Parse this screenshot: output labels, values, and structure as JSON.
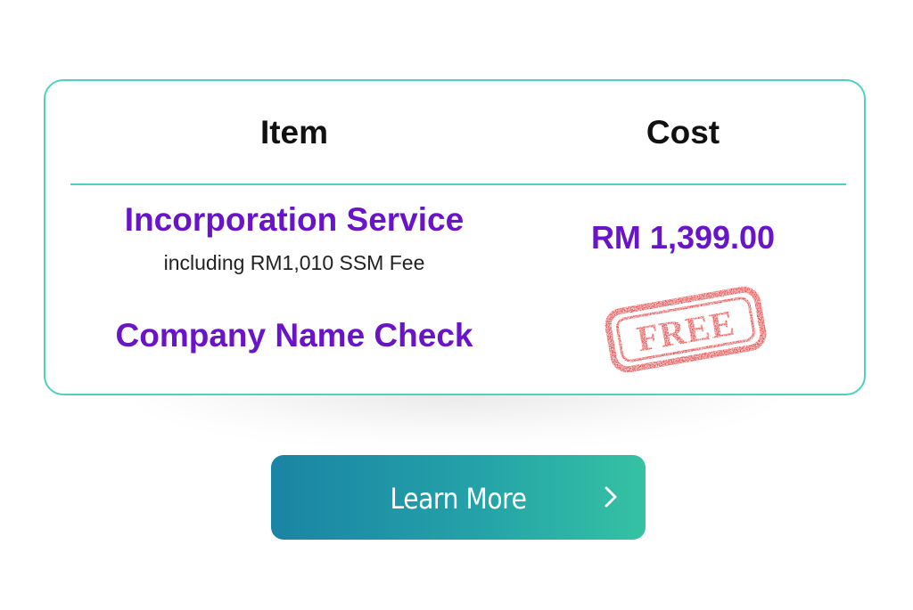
{
  "table": {
    "header_item": "Item",
    "header_cost": "Cost",
    "rows": [
      {
        "item": "Incorporation Service",
        "note": "including RM1,010 SSM Fee",
        "cost": "RM 1,399.00"
      },
      {
        "item": "Company Name Check",
        "cost": "FREE"
      }
    ]
  },
  "stamp": {
    "text": "FREE",
    "color": "#e12a2a",
    "icon": "free-stamp-icon"
  },
  "cta": {
    "label": "Learn More",
    "icon": "chevron-right-icon"
  },
  "colors": {
    "accent_purple": "#6a14c9",
    "border_teal": "#4fd1c1",
    "button_gradient_start": "#1a84a4",
    "button_gradient_end": "#35c2a3"
  }
}
